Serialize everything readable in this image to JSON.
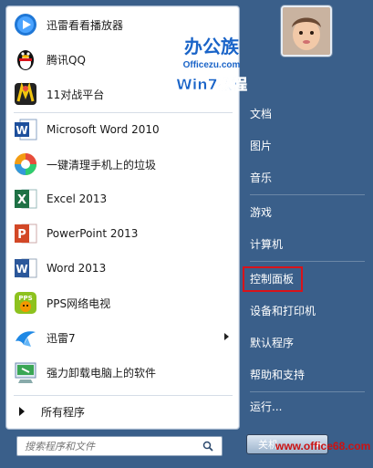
{
  "left_panel": {
    "items": [
      {
        "label": "迅雷看看播放器",
        "icon": "xunlei-kankan-icon"
      },
      {
        "label": "腾讯QQ",
        "icon": "qq-penguin-icon"
      },
      {
        "label": "11对战平台",
        "icon": "11-battle-icon"
      },
      {
        "label": "Microsoft Word 2010",
        "icon": "word-2010-icon"
      },
      {
        "label": "一键清理手机上的垃圾",
        "icon": "phone-cleaner-icon"
      },
      {
        "label": "Excel 2013",
        "icon": "excel-icon"
      },
      {
        "label": "PowerPoint 2013",
        "icon": "powerpoint-icon"
      },
      {
        "label": "Word 2013",
        "icon": "word-icon"
      },
      {
        "label": "PPS网络电视",
        "icon": "pps-icon"
      },
      {
        "label": "迅雷7",
        "icon": "xunlei-bird-icon"
      },
      {
        "label": "强力卸载电脑上的软件",
        "icon": "uninstaller-icon"
      }
    ],
    "all_programs": "所有程序",
    "search_placeholder": "搜索程序和文件"
  },
  "right_panel": {
    "items": [
      "文档",
      "图片",
      "音乐",
      "游戏",
      "计算机",
      "控制面板",
      "设备和打印机",
      "默认程序",
      "帮助和支持",
      "运行..."
    ],
    "shutdown_label": "关机"
  },
  "logo": {
    "line1": "办公族",
    "line2": "Officezu.com",
    "line3": "Win7教程"
  },
  "watermark": "www.office68.com",
  "colors": {
    "accent": "#1a64c8",
    "highlight_box": "#d8131a",
    "watermark": "#cc1212"
  }
}
